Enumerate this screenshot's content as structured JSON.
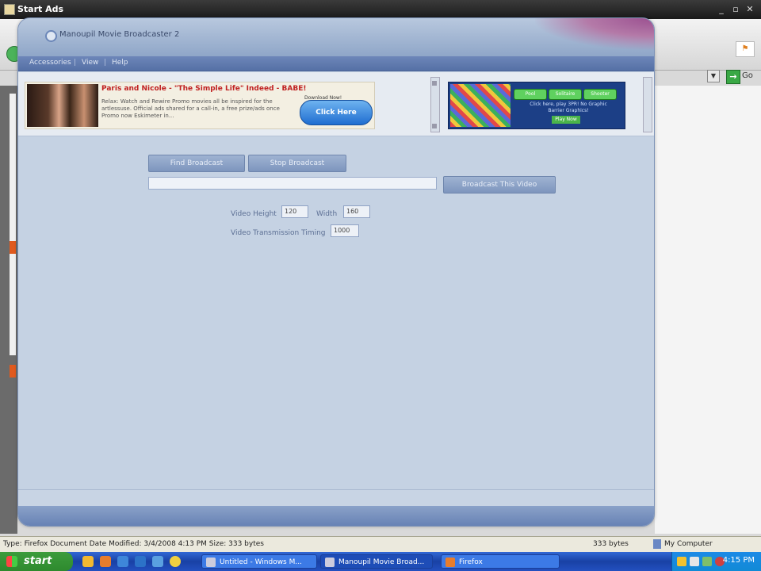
{
  "host_window": {
    "title": "Start Ads",
    "statusbar": {
      "text": "Type: Firefox Document Date Modified: 3/4/2008 4:13 PM Size: 333 bytes",
      "size": "333 bytes",
      "zone": "My Computer"
    },
    "go_label": "Go"
  },
  "app": {
    "title": "Manoupil Movie Broadcaster 2",
    "menu": [
      "Accessories",
      "View",
      "Help"
    ],
    "ad_left": {
      "headline": "Paris and Nicole - \"The Simple Life\" Indeed - BABE!",
      "body": "Relax: Watch and Rewire Promo movies all be inspired for the artlessuse. Official ads shared for a call-in, a free prize/ads once Promo now Eskimeter in...",
      "button_top": "Download Now!",
      "button": "Click Here"
    },
    "ad_right": {
      "pills": [
        "Pool",
        "Solitaire",
        "Shooter"
      ],
      "text": "Click here, play 3PR! No Graphic Barrier Graphics!",
      "play": "Play Now"
    },
    "buttons": {
      "b1": "Find Broadcast",
      "b2": "Stop Broadcast",
      "b3": "Broadcast This Video"
    },
    "url_value": "",
    "video_height_label": "Video Height",
    "video_height_value": "120",
    "width_label": "Width",
    "width_value": "160",
    "timing_label": "Video Transmission Timing",
    "timing_value": "1000"
  },
  "taskbar": {
    "start": "start",
    "tasks": [
      {
        "label": "Untitled - Windows M..."
      },
      {
        "label": "Manoupil Movie Broad..."
      },
      {
        "label": "Firefox"
      }
    ],
    "time": "4:15 PM"
  }
}
